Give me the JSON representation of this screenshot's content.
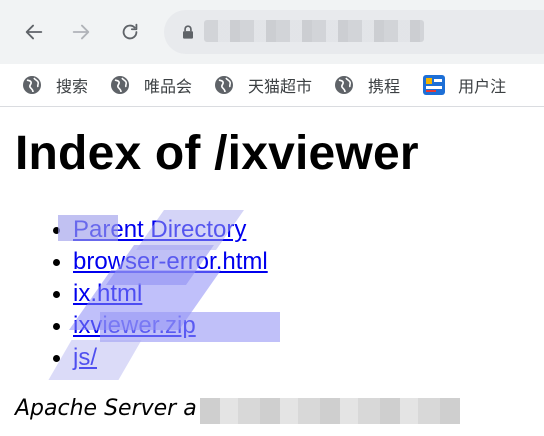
{
  "browser": {
    "address_bar": {
      "url_text": ""
    },
    "bookmarks": [
      {
        "label": "搜索",
        "icon": "globe-icon"
      },
      {
        "label": "唯品会",
        "icon": "globe-icon"
      },
      {
        "label": "天猫超市",
        "icon": "globe-icon"
      },
      {
        "label": "携程",
        "icon": "globe-icon"
      },
      {
        "label": "用户注",
        "icon": "user-app-icon"
      }
    ]
  },
  "page": {
    "title": "Index of /ixviewer",
    "links": [
      "Parent Directory",
      "browser-error.html",
      "ix.html",
      "ixviewer.zip",
      "js/"
    ],
    "footer": "Apache Server a"
  },
  "colors": {
    "toolbar_bg": "#f1f3f4",
    "omnibox_bg": "#e8eaed",
    "link": "#0000ee"
  }
}
